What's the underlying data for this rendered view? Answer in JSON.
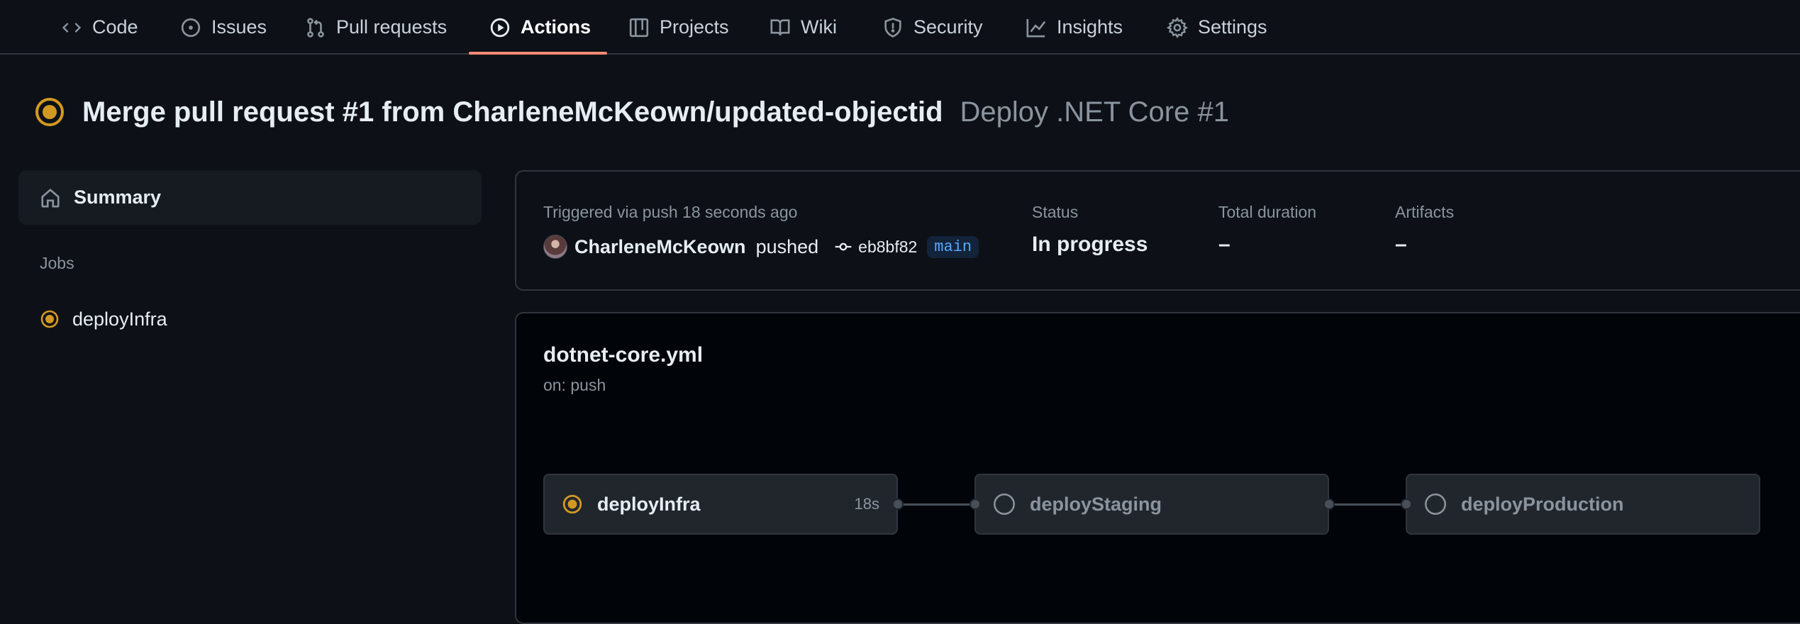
{
  "nav": {
    "tabs": [
      {
        "label": "Code",
        "icon": "code-icon"
      },
      {
        "label": "Issues",
        "icon": "issue-opened-icon"
      },
      {
        "label": "Pull requests",
        "icon": "git-pull-request-icon"
      },
      {
        "label": "Actions",
        "icon": "play-icon",
        "active": true
      },
      {
        "label": "Projects",
        "icon": "table-icon"
      },
      {
        "label": "Wiki",
        "icon": "book-icon"
      },
      {
        "label": "Security",
        "icon": "shield-icon"
      },
      {
        "label": "Insights",
        "icon": "graph-icon"
      },
      {
        "label": "Settings",
        "icon": "gear-icon"
      }
    ],
    "active_underline_color": "#fd8c73"
  },
  "run": {
    "title": "Merge pull request #1 from CharleneMcKeown/updated-objectid",
    "workflow_and_number": "Deploy .NET Core #1",
    "status_color": "#d29922"
  },
  "sidebar": {
    "summary_label": "Summary",
    "jobs_heading": "Jobs",
    "jobs": [
      {
        "label": "deployInfra",
        "status": "in_progress"
      }
    ]
  },
  "summary": {
    "trigger_text": "Triggered via push 18 seconds ago",
    "actor": "CharleneMcKeown",
    "action": "pushed",
    "commit_sha": "eb8bf82",
    "branch": "main",
    "status_label": "Status",
    "status_value": "In progress",
    "duration_label": "Total duration",
    "duration_value": "–",
    "artifacts_label": "Artifacts",
    "artifacts_value": "–"
  },
  "workflow": {
    "file": "dotnet-core.yml",
    "trigger": "on: push",
    "jobs": [
      {
        "name": "deployInfra",
        "status": "in_progress",
        "duration": "18s"
      },
      {
        "name": "deployStaging",
        "status": "pending",
        "duration": ""
      },
      {
        "name": "deployProduction",
        "status": "pending",
        "duration": ""
      }
    ]
  }
}
